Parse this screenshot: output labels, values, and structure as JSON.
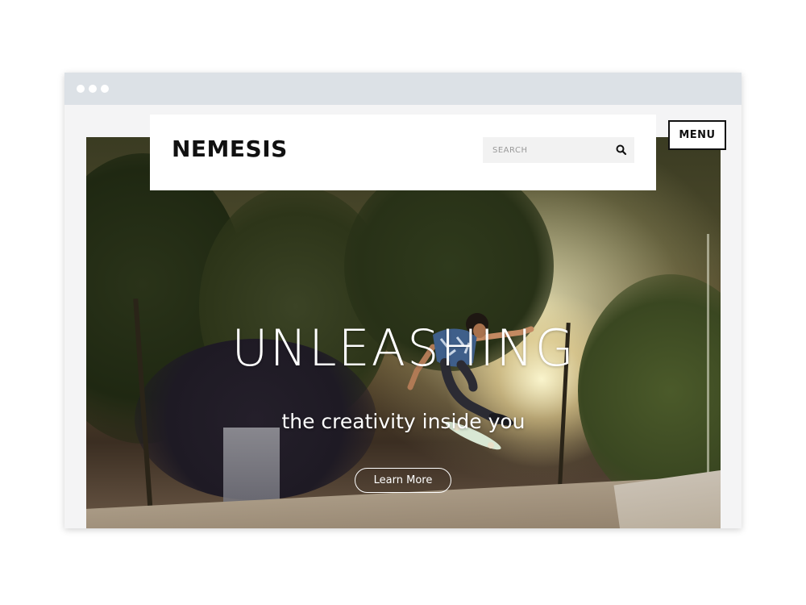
{
  "window": {
    "controls": [
      "dot",
      "dot",
      "dot"
    ]
  },
  "header": {
    "logo": "NEMESIS",
    "search": {
      "placeholder": "SEARCH",
      "value": "",
      "icon": "search-icon"
    },
    "menu_label": "MENU"
  },
  "hero": {
    "title": "UNLEASHING",
    "subtitle": "the creativity inside you",
    "cta_label": "Learn More"
  }
}
